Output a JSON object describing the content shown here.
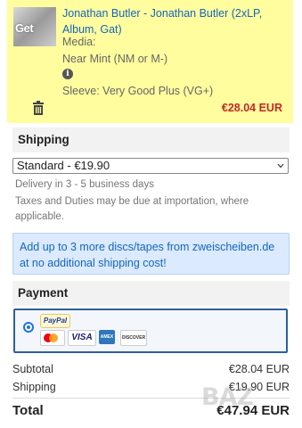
{
  "cart_item": {
    "thumb_text": "Get",
    "title": "Jonathan Butler - Jonathan Butler (2xLP, Album, Gat)",
    "media_label": "Media:",
    "media_value": "Near Mint (NM or M-)",
    "sleeve": "Sleeve: Very Good Plus (VG+)",
    "price": "€28.04 EUR"
  },
  "shipping": {
    "heading": "Shipping",
    "selected_option": "Standard - €19.90",
    "delivery_text": "Delivery in 3 - 5 business days",
    "tax_text": "Taxes and Duties may be due at importation, where applicable.",
    "notice": "Add up to 3 more discs/tapes from zweischeiben.de at no additional shipping cost!"
  },
  "payment": {
    "heading": "Payment",
    "paypal_label": "PayPal",
    "cards": {
      "mastercard": "MasterCard",
      "visa": "VISA",
      "amex": "AMERICAN EXPRESS",
      "discover": "DISCOVER"
    }
  },
  "summary": {
    "subtotal_label": "Subtotal",
    "subtotal_value": "€28.04 EUR",
    "shipping_label": "Shipping",
    "shipping_value": "€19.90 EUR",
    "total_label": "Total",
    "total_value": "€47.94 EUR"
  },
  "watermark_text": "BAZ"
}
